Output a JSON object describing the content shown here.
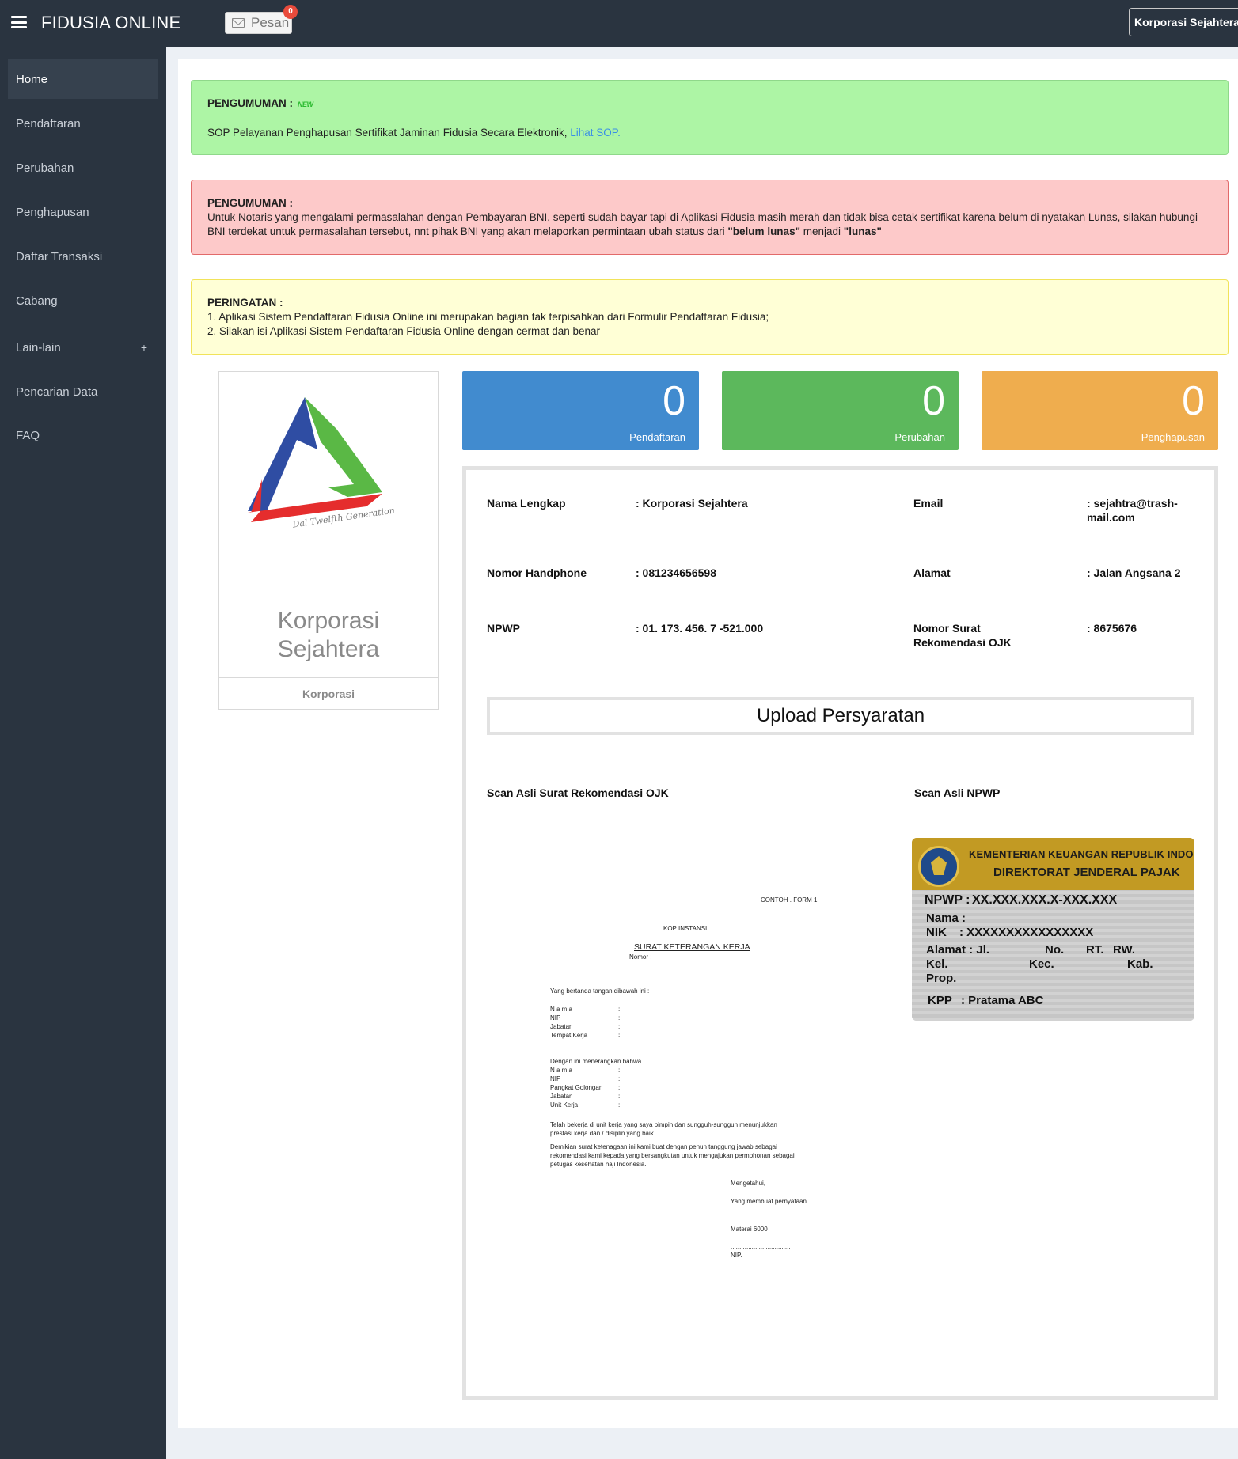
{
  "app": {
    "title": "FIDUSIA ONLINE",
    "pesan_label": "Pesan",
    "pesan_badge": "0",
    "user_menu": "Korporasi Sejahtera"
  },
  "sidebar": {
    "items": [
      {
        "label": "Home"
      },
      {
        "label": "Pendaftaran"
      },
      {
        "label": "Perubahan"
      },
      {
        "label": "Penghapusan"
      },
      {
        "label": "Daftar Transaksi"
      },
      {
        "label": "Cabang"
      },
      {
        "label": "Lain-lain",
        "expander": "+"
      },
      {
        "label": "Pencarian Data"
      },
      {
        "label": "FAQ"
      }
    ]
  },
  "announcements": {
    "green": {
      "heading": "PENGUMUMAN :",
      "new_tag": "NEW",
      "text": "SOP Pelayanan Penghapusan Sertifikat Jaminan Fidusia Secara Elektronik,",
      "link": "Lihat SOP."
    },
    "red": {
      "heading": "PENGUMUMAN :",
      "text_1": "Untuk Notaris yang mengalami permasalahan dengan Pembayaran BNI, seperti sudah bayar tapi di Aplikasi Fidusia masih merah dan tidak bisa cetak sertifikat karena belum di nyatakan Lunas, silakan hubungi BNI terdekat untuk permasalahan tersebut, nnt pihak BNI yang akan melaporkan permintaan ubah status dari",
      "bold_1": "\"belum lunas\"",
      "text_2": "menjadi",
      "bold_2": "\"lunas\""
    },
    "yellow": {
      "heading": "PERINGATAN :",
      "line_1": "1. Aplikasi Sistem Pendaftaran Fidusia Online ini merupakan bagian tak terpisahkan dari Formulir Pendaftaran Fidusia;",
      "line_2": "2. Silakan isi Aplikasi Sistem Pendaftaran Fidusia Online dengan cermat dan benar"
    }
  },
  "profile": {
    "logo_caption": "Dal Twelfth Generation",
    "name_line_1": "Korporasi",
    "name_line_2": "Sejahtera",
    "type": "Korporasi"
  },
  "stats": [
    {
      "value": "0",
      "label": "Pendaftaran",
      "color": "#418bcf"
    },
    {
      "value": "0",
      "label": "Perubahan",
      "color": "#5cb85c"
    },
    {
      "value": "0",
      "label": "Penghapusan",
      "color": "#efad4e"
    }
  ],
  "info": {
    "nama_label": "Nama Lengkap",
    "nama_value": ": Korporasi Sejahtera",
    "email_label": "Email",
    "email_value_1": ": sejahtra@trash-",
    "email_value_2": "mail.com",
    "hp_label": "Nomor Handphone",
    "hp_value": ": 081234656598",
    "alamat_label": "Alamat",
    "alamat_value": ": Jalan Angsana 2",
    "npwp_label": "NPWP",
    "npwp_value": ": 01. 173. 456. 7 -521.000",
    "ojk_label_1": "Nomor Surat",
    "ojk_label_2": "Rekomendasi OJK",
    "ojk_value": ": 8675676"
  },
  "upload": {
    "title": "Upload Persyaratan",
    "scan_ojk_label": "Scan Asli Surat Rekomendasi OJK",
    "scan_npwp_label": "Scan Asli NPWP"
  },
  "scan_doc": {
    "corner": "CONTOH . FORM 1",
    "kop": "KOP INSTANSI",
    "title": "SURAT KETERANGAN KERJA",
    "nomor": "Nomor :",
    "intro": "Yang bertanda tangan dibawah ini :",
    "f1": [
      "N a m a",
      "NIP",
      "Jabatan",
      "Tempat Kerja"
    ],
    "intro2": "Dengan ini menerangkan bahwa :",
    "f2": [
      "N a m a",
      "NIP",
      "Pangkat Golongan",
      "Jabatan",
      "Unit Kerja"
    ],
    "colon": ":",
    "p1": "Telah bekerja di unit kerja yang saya pimpin dan sungguh-sungguh menunjukkan",
    "p1b": "prestasi kerja dan / disiplin yang baik.",
    "p2": "Demikian surat ketenagaan ini kami buat dengan penuh tanggung jawab sebagai",
    "p2b": "rekomendasi kami kepada yang bersangkutan untuk mengajukan permohonan sebagai",
    "p2c": "petugas kesehatan haji Indonesia.",
    "sig1": "Mengetahui,",
    "sig2": "Yang membuat pernyataan",
    "sig3": "Materai 6000",
    "sig4": "..................................",
    "sig5": "NIP."
  },
  "npwp_card": {
    "title_1": "KEMENTERIAN KEUANGAN REPUBLIK INDONESIA",
    "title_2": "DIREKTORAT JENDERAL PAJAK",
    "npwp_label": "NPWP :",
    "npwp_value": "XX.XXX.XXX.X-XXX.XXX",
    "nama": "Nama :",
    "nik_label": "NIK",
    "nik_value": ": XXXXXXXXXXXXXXXX",
    "alamat": "Alamat : Jl.",
    "no": "No.",
    "rt": "RT.",
    "rw": "RW.",
    "kel": "Kel.",
    "kec": "Kec.",
    "kab": "Kab.",
    "prop": "Prop.",
    "kpp_label": "KPP",
    "kpp_value": ": Pratama ABC"
  }
}
